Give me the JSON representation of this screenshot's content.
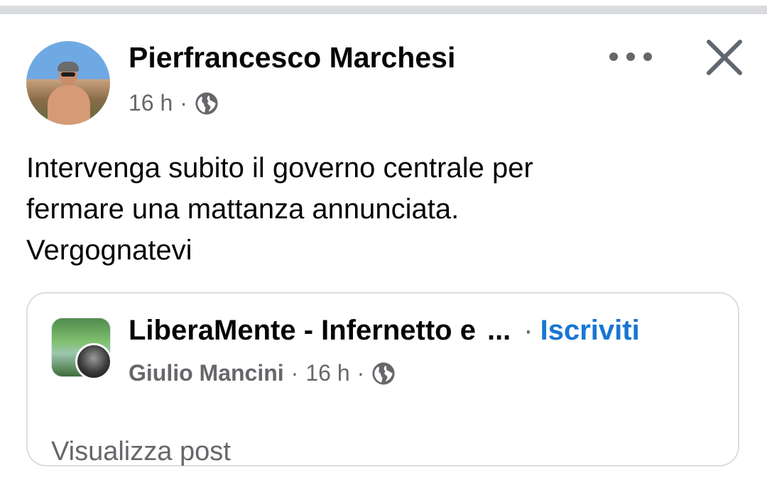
{
  "post": {
    "author": "Pierfrancesco Marchesi",
    "time": "16 h",
    "separator": "·",
    "visibility_icon": "globe-icon",
    "text_lines": [
      "Intervenga subito il governo centrale per",
      "fermare una mattanza annunciata.",
      "Vergognatevi"
    ]
  },
  "actions": {
    "more_icon": "more-icon",
    "close_icon": "close-icon"
  },
  "shared_card": {
    "group_name": "LiberaMente - Infernetto e",
    "ellipsis": "...",
    "separator": "·",
    "subscribe_label": "Iscriviti",
    "member_name": "Giulio Mancini",
    "time": "16 h",
    "visibility_icon": "globe-icon",
    "view_post_label": "Visualizza post"
  },
  "colors": {
    "link_blue": "#1876d2",
    "secondary_text": "#65676b",
    "primary_text": "#050505"
  }
}
